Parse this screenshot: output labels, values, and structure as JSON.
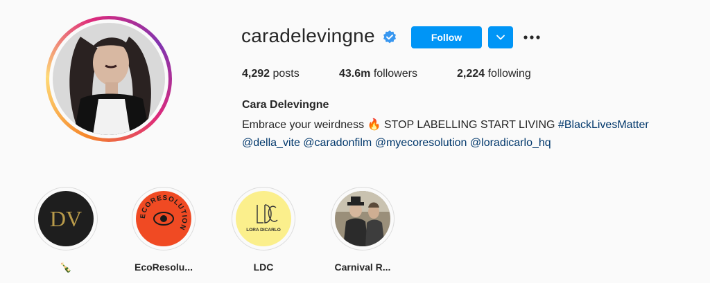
{
  "profile": {
    "username": "caradelevingne",
    "verified_icon": "verified-badge-icon",
    "follow_label": "Follow",
    "dropdown_icon": "chevron-down-icon",
    "more_icon": "more-options-icon",
    "stats": {
      "posts_count": "4,292",
      "posts_label": " posts",
      "followers_count": "43.6m",
      "followers_label": " followers",
      "following_count": "2,224",
      "following_label": " following"
    },
    "full_name": "Cara Delevingne",
    "bio": {
      "line1_text": "Embrace your weirdness 🔥 STOP LABELLING START LIVING ",
      "hashtag": "#BlackLivesMatter",
      "mentions": [
        "@della_vite",
        "@caradonfilm",
        "@myecoresolution",
        "@loradicarlo_hq"
      ]
    }
  },
  "highlights": [
    {
      "label": "🍾",
      "cover_text": "DV"
    },
    {
      "label": "EcoResolu...",
      "cover_text": "ECORESOLUTION"
    },
    {
      "label": "LDC",
      "cover_text": "LORA DICARLO"
    },
    {
      "label": "Carnival R...",
      "cover_text": ""
    }
  ],
  "colors": {
    "accent": "#0095f6",
    "link": "#00376b",
    "verified": "#3897f0",
    "text": "#262626",
    "background": "#fafafa"
  }
}
